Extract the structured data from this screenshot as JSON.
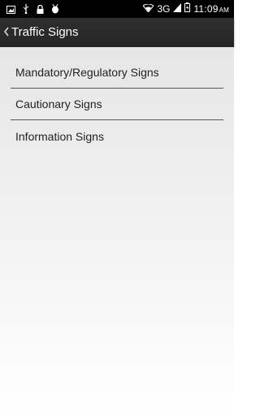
{
  "status_bar": {
    "network": "3G",
    "time": "11:09",
    "ampm": "AM",
    "icons": [
      "gallery-icon",
      "usb-icon",
      "lock-icon",
      "android-debug-icon",
      "wifi-icon",
      "signal-icon",
      "battery-icon"
    ]
  },
  "app_bar": {
    "back_icon": "chevron-left-icon",
    "title": "Traffic Signs"
  },
  "menu": {
    "items": [
      {
        "label": "Mandatory/Regulatory Signs"
      },
      {
        "label": "Cautionary Signs"
      },
      {
        "label": "Information Signs"
      }
    ]
  },
  "colors": {
    "status_bar_bg": "#000000",
    "app_bar_bg": "#2b2b2b",
    "divider": "#555555",
    "text": "#222222"
  }
}
